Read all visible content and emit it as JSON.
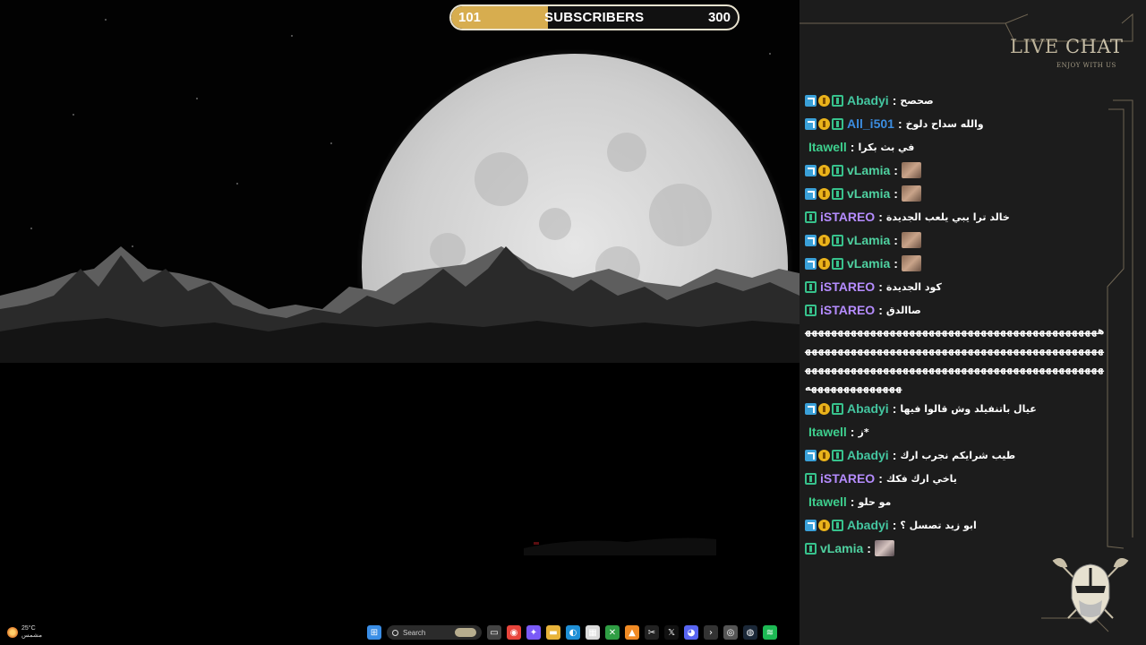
{
  "subscriber_goal": {
    "current": "101",
    "label": "SUBSCRIBERS",
    "target": "300",
    "progress_fraction": 0.337,
    "fill_color": "#d7ad4f"
  },
  "chat_panel": {
    "title_part1": "LIVE",
    "title_part2": "CHAT",
    "subtitle": "ENJOY WITH US",
    "accent_color": "#c8bfa8"
  },
  "users": {
    "Abadyi": {
      "color": "#44c6a0",
      "badges": [
        "arrow-badge",
        "coin-badge",
        "sub-badge"
      ]
    },
    "All_i501": {
      "color": "#3b8de0",
      "badges": [
        "arrow-badge",
        "coin-badge",
        "sub-badge"
      ]
    },
    "Itawell": {
      "color": "#3ecf8e",
      "badges": []
    },
    "vLamia": {
      "color": "#4fd1a0",
      "badges": [
        "arrow-badge",
        "coin-badge",
        "sub-badge"
      ]
    },
    "iSTAREO": {
      "color": "#b58cff",
      "badges": [
        "sub-badge"
      ]
    }
  },
  "messages": [
    {
      "user": "Abadyi",
      "sep": ":",
      "text": "صحصح"
    },
    {
      "user": "All_i501",
      "sep": ":",
      "text": "والله سداح دلوخ"
    },
    {
      "user": "Itawell",
      "sep": ":",
      "text": "في بث بكرا"
    },
    {
      "user": "vLamia",
      "sep": ":",
      "text": "",
      "emote": "emote-face"
    },
    {
      "user": "vLamia",
      "sep": ":",
      "text": "",
      "emote": "emote-face"
    },
    {
      "user": "iSTAREO",
      "sep": ":",
      "text": "خالد ترا يبي يلعب الجديدة"
    },
    {
      "user": "vLamia",
      "sep": ":",
      "text": "",
      "emote": "emote-face"
    },
    {
      "user": "vLamia",
      "sep": ":",
      "text": "",
      "emote": "emote-face"
    },
    {
      "user": "iSTAREO",
      "sep": ":",
      "text": "كود الجديدة"
    },
    {
      "user": "iSTAREO",
      "sep": ":",
      "text": "صاالدق"
    },
    {
      "user": "",
      "sep": "",
      "text": "ههههههههههههههههههههههههههههههههههههههههههههههههههههههههههههههههههههههههههههههههههههههههههههههههههههههههههههههههههههههههههههههههههههههههههههههههههههههههه",
      "wrap": true
    },
    {
      "user": "Abadyi",
      "sep": ":",
      "text": "عيال باتنفيلد وش قالوا فيها"
    },
    {
      "user": "Itawell",
      "sep": ":",
      "text": "ز*"
    },
    {
      "user": "Abadyi",
      "sep": ":",
      "text": "طيب شرايكم نجرب ارك"
    },
    {
      "user": "iSTAREO",
      "sep": ":",
      "text": "ياخي ارك فكك"
    },
    {
      "user": "Itawell",
      "sep": ":",
      "text": "مو حلو"
    },
    {
      "user": "Abadyi",
      "sep": ":",
      "text": "ابو زيد تصسل ؟"
    },
    {
      "user": "vLamia",
      "sep": ":",
      "text": "",
      "emote": "emote-face-small",
      "partial_badges": true
    }
  ],
  "taskbar": {
    "weather_temp": "25°C",
    "weather_desc": "مشمس",
    "search_placeholder": "Search",
    "apps": [
      "windows-start-icon",
      "task-view-icon",
      "chrome-icon",
      "copilot-icon",
      "file-explorer-icon",
      "edge-icon",
      "store-icon",
      "xbox-icon",
      "vlc-icon",
      "capcut-icon",
      "x-icon",
      "discord-icon",
      "terminal-icon",
      "obs-icon",
      "steam-icon",
      "spotify-icon"
    ]
  }
}
